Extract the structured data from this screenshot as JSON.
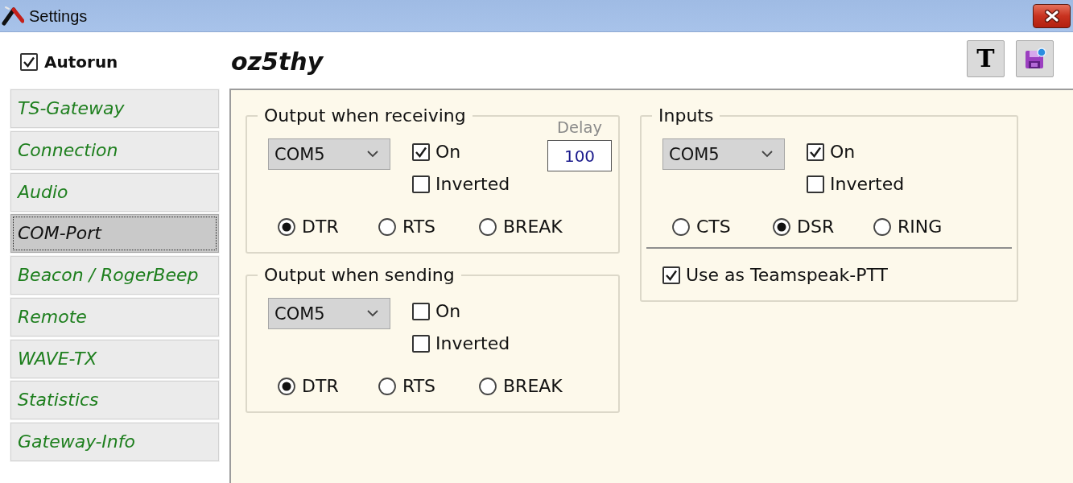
{
  "window": {
    "title": "Settings"
  },
  "autorun": {
    "label": "Autorun",
    "checked": true
  },
  "profile_name": "oz5thy",
  "toolbar": [
    {
      "kind": "font",
      "label": "T"
    },
    {
      "kind": "save"
    }
  ],
  "sidebar": {
    "items": [
      {
        "label": "TS-Gateway",
        "selected": false
      },
      {
        "label": "Connection",
        "selected": false
      },
      {
        "label": "Audio",
        "selected": false
      },
      {
        "label": "COM-Port",
        "selected": true
      },
      {
        "label": "Beacon / RogerBeep",
        "selected": false
      },
      {
        "label": "Remote",
        "selected": false
      },
      {
        "label": "WAVE-TX",
        "selected": false
      },
      {
        "label": "Statistics",
        "selected": false
      },
      {
        "label": "Gateway-Info",
        "selected": false
      }
    ]
  },
  "columns": [
    {
      "groups": [
        {
          "title": "Output when receiving",
          "port": "COM5",
          "options": [
            {
              "label": "On",
              "checked": true
            },
            {
              "label": "Inverted",
              "checked": false
            }
          ],
          "delay": {
            "label": "Delay",
            "value": "100"
          },
          "signals": [
            {
              "label": "DTR",
              "selected": true
            },
            {
              "label": "RTS",
              "selected": false
            },
            {
              "label": "BREAK",
              "selected": false
            }
          ]
        },
        {
          "title": "Output when sending",
          "port": "COM5",
          "options": [
            {
              "label": "On",
              "checked": false
            },
            {
              "label": "Inverted",
              "checked": false
            }
          ],
          "signals": [
            {
              "label": "DTR",
              "selected": true
            },
            {
              "label": "RTS",
              "selected": false
            },
            {
              "label": "BREAK",
              "selected": false
            }
          ]
        }
      ]
    },
    {
      "groups": [
        {
          "title": "Inputs",
          "port": "COM5",
          "options": [
            {
              "label": "On",
              "checked": true
            },
            {
              "label": "Inverted",
              "checked": false
            }
          ],
          "signals": [
            {
              "label": "CTS",
              "selected": false
            },
            {
              "label": "DSR",
              "selected": true
            },
            {
              "label": "RING",
              "selected": false
            }
          ],
          "ptt": {
            "label": "Use as Teamspeak-PTT",
            "checked": true
          }
        }
      ]
    }
  ]
}
